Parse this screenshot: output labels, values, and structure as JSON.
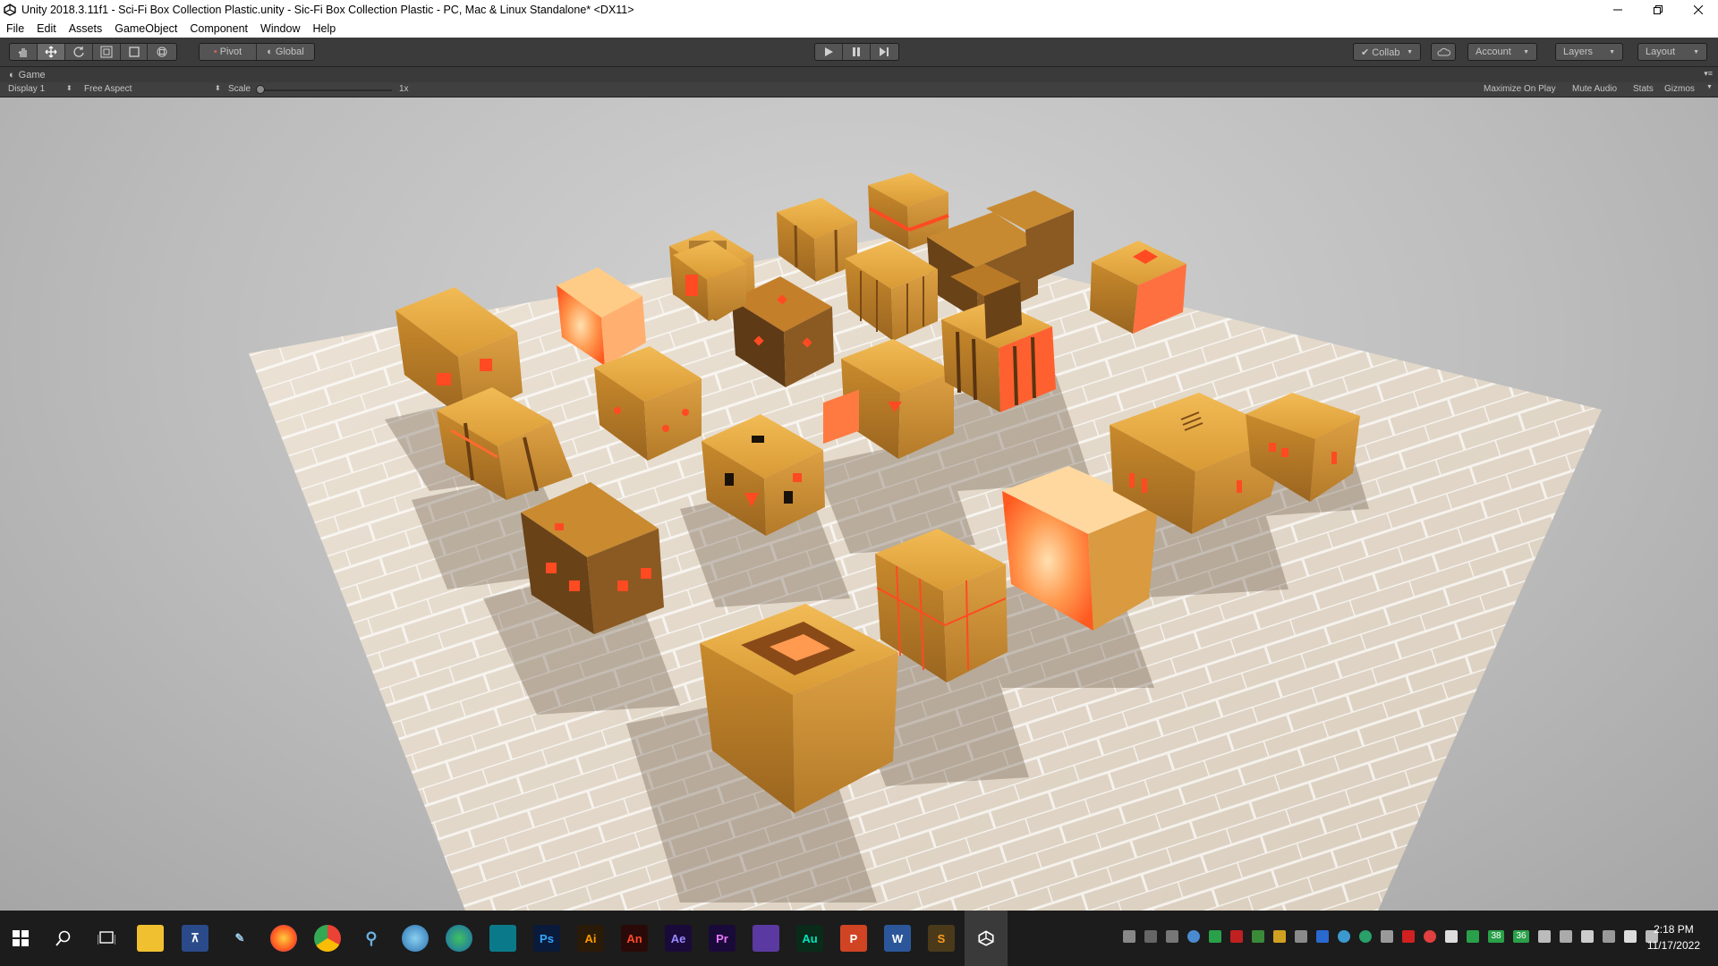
{
  "window": {
    "title": "Unity 2018.3.11f1 - Sci-Fi Box Collection Plastic.unity - Sic-Fi Box Collection Plastic - PC, Mac & Linux Standalone* <DX11>",
    "minimize_icon": "minimize-icon",
    "restore_icon": "restore-icon",
    "close_icon": "close-icon"
  },
  "menu": [
    "File",
    "Edit",
    "Assets",
    "GameObject",
    "Component",
    "Window",
    "Help"
  ],
  "toolbar": {
    "tools": [
      "hand-tool-icon",
      "move-tool-icon",
      "rotate-tool-icon",
      "scale-tool-icon",
      "rect-tool-icon",
      "transform-tool-icon"
    ],
    "pivot_label": "Pivot",
    "global_label": "Global",
    "play_icon": "play-icon",
    "pause_icon": "pause-icon",
    "step_icon": "step-icon",
    "collab_label": "Collab",
    "account_label": "Account",
    "layers_label": "Layers",
    "layout_label": "Layout"
  },
  "game_view": {
    "tab_label": "Game",
    "display_label": "Display 1",
    "aspect_label": "Free Aspect",
    "scale_label": "Scale",
    "scale_value": "1x",
    "maximize_label": "Maximize On Play",
    "mute_label": "Mute Audio",
    "stats_label": "Stats",
    "gizmos_label": "Gizmos"
  },
  "taskbar": {
    "apps": [
      {
        "name": "start-icon",
        "label": ""
      },
      {
        "name": "search-icon",
        "label": ""
      },
      {
        "name": "task-view-icon",
        "label": ""
      },
      {
        "name": "file-explorer-icon",
        "label": ""
      },
      {
        "name": "app-icon-1",
        "label": ""
      },
      {
        "name": "app-icon-2",
        "label": ""
      },
      {
        "name": "firefox-icon",
        "label": ""
      },
      {
        "name": "chrome-icon",
        "label": ""
      },
      {
        "name": "app-icon-3",
        "label": ""
      },
      {
        "name": "app-icon-4",
        "label": ""
      },
      {
        "name": "app-icon-5",
        "label": ""
      },
      {
        "name": "app-icon-6",
        "label": ""
      },
      {
        "name": "photoshop-icon",
        "label": "Ps"
      },
      {
        "name": "illustrator-icon",
        "label": "Ai"
      },
      {
        "name": "animate-icon",
        "label": "An"
      },
      {
        "name": "after-effects-icon",
        "label": "Ae"
      },
      {
        "name": "premiere-icon",
        "label": "Pr"
      },
      {
        "name": "visual-studio-icon",
        "label": ""
      },
      {
        "name": "audition-icon",
        "label": "Au"
      },
      {
        "name": "powerpoint-icon",
        "label": "P"
      },
      {
        "name": "word-icon",
        "label": "W"
      },
      {
        "name": "sublime-icon",
        "label": ""
      },
      {
        "name": "unity-icon",
        "label": ""
      }
    ],
    "tray_badges": [
      "38",
      "36"
    ],
    "time": "2:18 PM",
    "date": "11/17/2022"
  },
  "colors": {
    "toolbar_bg": "#3b3b3b",
    "box_orange": "#e0a040",
    "glow_red": "#ff5a2a",
    "floor": "#e8ddd0"
  }
}
